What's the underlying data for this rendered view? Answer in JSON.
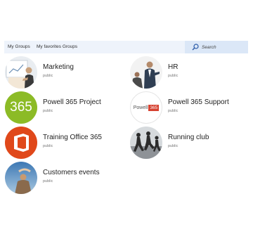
{
  "tabs": {
    "my_groups": "My Groups",
    "favorites": "My favorites Groups"
  },
  "search": {
    "placeholder": "Search"
  },
  "groups": [
    {
      "name": "Marketing",
      "privacy": "public",
      "avatar_icon": "marketing-photo"
    },
    {
      "name": "HR",
      "privacy": "public",
      "avatar_icon": "hr-photo"
    },
    {
      "name": "Powell 365 Project",
      "privacy": "public",
      "avatar_icon": "365-logo",
      "avatar_text": "365"
    },
    {
      "name": "Powell 365 Support",
      "privacy": "public",
      "avatar_icon": "powell-365-logo",
      "logo_word": "Powell",
      "logo_badge": "365"
    },
    {
      "name": "Training Office 365",
      "privacy": "public",
      "avatar_icon": "office-logo"
    },
    {
      "name": "Running club",
      "privacy": "public",
      "avatar_icon": "running-photo"
    },
    {
      "name": "Customers events",
      "privacy": "public",
      "avatar_icon": "customers-photo"
    }
  ],
  "colors": {
    "tab_bar": "#eef3fb",
    "search_bg": "#dbe7f7",
    "accent_green": "#8cbb26",
    "office_orange": "#e0481a",
    "powell_red": "#d64130"
  }
}
